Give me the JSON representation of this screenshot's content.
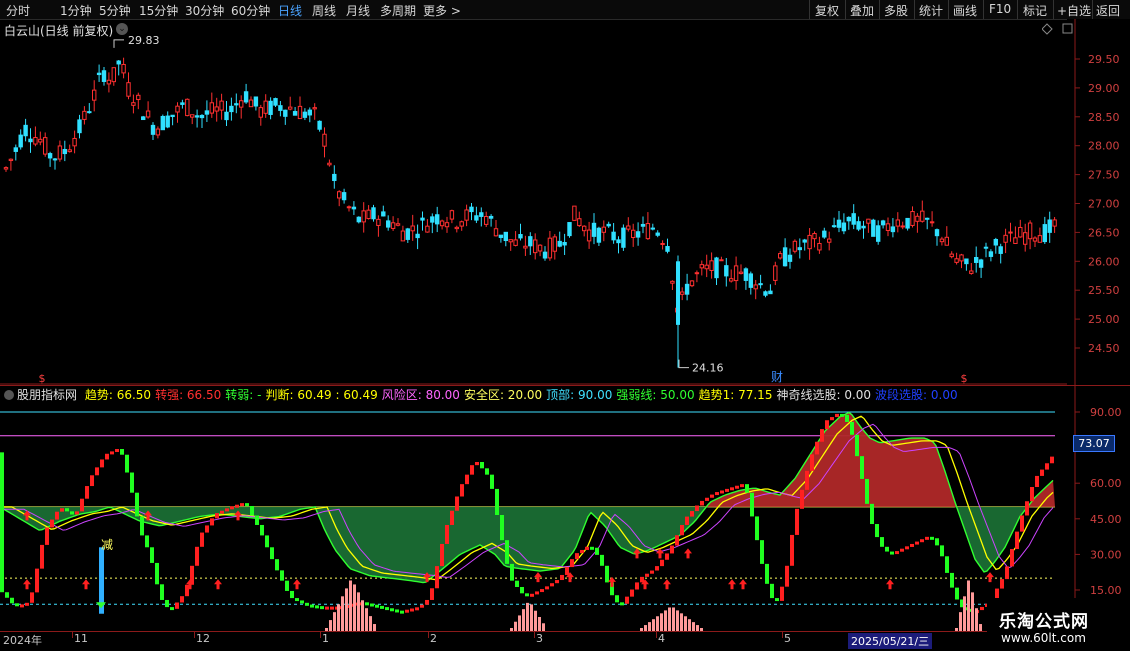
{
  "toolbar": {
    "periods": [
      "分时",
      "1分钟",
      "5分钟",
      "15分钟",
      "30分钟",
      "60分钟",
      "日线",
      "周线",
      "月线",
      "多周期",
      "更多 >"
    ],
    "active": "日线",
    "right_buttons": [
      "复权",
      "叠加",
      "多股",
      "统计",
      "画线",
      "F10",
      "标记",
      "+自选",
      "返回"
    ]
  },
  "stock": {
    "title": "白云山(日线 前复权)",
    "high_label": "29.83",
    "low_label": "24.16",
    "event_marks": [
      "$",
      "财",
      "$"
    ]
  },
  "price_axis": {
    "ticks": [
      "29.50",
      "29.00",
      "28.50",
      "28.00",
      "27.50",
      "27.00",
      "26.50",
      "26.00",
      "25.50",
      "25.00",
      "24.50"
    ]
  },
  "indicator": {
    "name": "股朋指标网",
    "fields": [
      {
        "text": "趋势: 66.50",
        "color": "#ffff00"
      },
      {
        "text": "转强: 66.50",
        "color": "#ff3030"
      },
      {
        "text": "转弱: -",
        "color": "#30ff30"
      },
      {
        "text": "判断: 60.49 : 60.49",
        "color": "#ffff00"
      },
      {
        "text": "风险区: 80.00",
        "color": "#ff66ff"
      },
      {
        "text": "安全区: 20.00",
        "color": "#ffff60"
      },
      {
        "text": "顶部: 90.00",
        "color": "#40e0ff"
      },
      {
        "text": "强弱线: 50.00",
        "color": "#30ff30"
      },
      {
        "text": "趋势1: 77.15",
        "color": "#ffff00"
      },
      {
        "text": "神奇线选股: 0.00",
        "color": "#e0e0e0"
      },
      {
        "text": "波段选股: 0.00",
        "color": "#2040ff"
      }
    ],
    "axis_ticks": [
      "90.00",
      "60.00",
      "45.00",
      "30.00",
      "15.00"
    ],
    "current_value": "73.07",
    "signal_label": "减"
  },
  "date_axis": {
    "labels": [
      "2024年",
      "11",
      "12",
      "1",
      "2",
      "3",
      "4",
      "5"
    ],
    "cursor_date": "2025/05/21/三"
  },
  "watermark": {
    "title": "乐淘公式网",
    "url": "www.60lt.com"
  },
  "colors": {
    "up": "#ff3030",
    "down": "#30e0ff",
    "ind_up": "#ff2020",
    "ind_down": "#20ff20",
    "red_area": "#b02828",
    "green_area": "#1a6e34"
  }
}
